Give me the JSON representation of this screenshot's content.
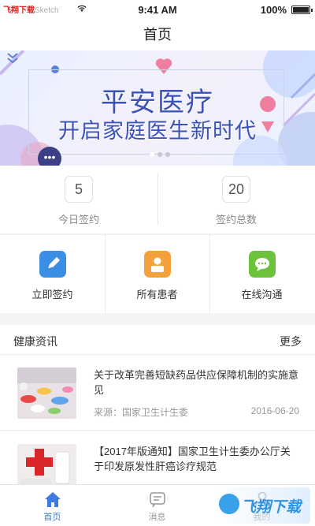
{
  "status_bar": {
    "carrier": "飞翔下载",
    "carrier_sub": "Sketch",
    "time": "9:41 AM",
    "battery": "100%"
  },
  "nav": {
    "title": "首页"
  },
  "banner": {
    "title": "平安医疗",
    "subtitle": "开启家庭医生新时代",
    "bubble": "•••",
    "page_count": 3,
    "active_page": 1
  },
  "stats": [
    {
      "value": "5",
      "label": "今日签约"
    },
    {
      "value": "20",
      "label": "签约总数"
    }
  ],
  "actions": [
    {
      "label": "立即签约",
      "icon": "pencil-icon",
      "color": "#3a8ee6"
    },
    {
      "label": "所有患者",
      "icon": "patient-icon",
      "color": "#f5a13b"
    },
    {
      "label": "在线沟通",
      "icon": "chat-icon",
      "color": "#6cc23a"
    }
  ],
  "news": {
    "title": "健康资讯",
    "more": "更多",
    "items": [
      {
        "title": "关于改革完善短缺药品供应保障机制的实施意见",
        "source": "来源：国家卫生计生委",
        "date": "2016-06-20",
        "thumb": "pills-photo"
      },
      {
        "title": "【2017年版通知】国家卫生计生委办公厅关于印发原发性肝癌诊疗规范",
        "source": "",
        "date": "",
        "thumb": "medical-cross-photo"
      }
    ]
  },
  "tabbar": {
    "tabs": [
      {
        "label": "首页",
        "icon": "home-icon",
        "active": true
      },
      {
        "label": "消息",
        "icon": "message-icon",
        "active": false
      },
      {
        "label": "我的",
        "icon": "user-icon",
        "active": false
      }
    ]
  },
  "watermark": {
    "text": "飞翔下载"
  },
  "colors": {
    "accent": "#3d7be0",
    "banner_text": "#3b52b8"
  }
}
